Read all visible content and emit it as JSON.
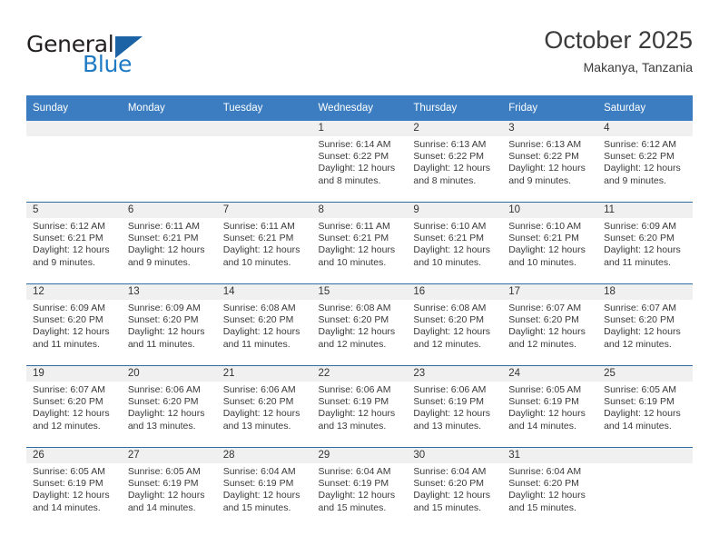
{
  "brand": {
    "word_one": "General",
    "word_two": "Blue",
    "triangle_color": "#1b63a5",
    "blue_color": "#1f7ac4"
  },
  "header": {
    "title": "October 2025",
    "subtitle": "Makanya, Tanzania",
    "header_bg": "#3b7dc0",
    "row_divider": "#2e6da4",
    "daynum_bg": "#f0f0f0"
  },
  "weekdays": [
    "Sunday",
    "Monday",
    "Tuesday",
    "Wednesday",
    "Thursday",
    "Friday",
    "Saturday"
  ],
  "labels": {
    "sunrise": "Sunrise:",
    "sunset": "Sunset:",
    "daylight": "Daylight:"
  },
  "weeks": [
    [
      {
        "day": "",
        "sunrise": "",
        "sunset": "",
        "daylight_1": "",
        "daylight_2": ""
      },
      {
        "day": "",
        "sunrise": "",
        "sunset": "",
        "daylight_1": "",
        "daylight_2": ""
      },
      {
        "day": "",
        "sunrise": "",
        "sunset": "",
        "daylight_1": "",
        "daylight_2": ""
      },
      {
        "day": "1",
        "sunrise": "Sunrise: 6:14 AM",
        "sunset": "Sunset: 6:22 PM",
        "daylight_1": "Daylight: 12 hours",
        "daylight_2": "and 8 minutes."
      },
      {
        "day": "2",
        "sunrise": "Sunrise: 6:13 AM",
        "sunset": "Sunset: 6:22 PM",
        "daylight_1": "Daylight: 12 hours",
        "daylight_2": "and 8 minutes."
      },
      {
        "day": "3",
        "sunrise": "Sunrise: 6:13 AM",
        "sunset": "Sunset: 6:22 PM",
        "daylight_1": "Daylight: 12 hours",
        "daylight_2": "and 9 minutes."
      },
      {
        "day": "4",
        "sunrise": "Sunrise: 6:12 AM",
        "sunset": "Sunset: 6:22 PM",
        "daylight_1": "Daylight: 12 hours",
        "daylight_2": "and 9 minutes."
      }
    ],
    [
      {
        "day": "5",
        "sunrise": "Sunrise: 6:12 AM",
        "sunset": "Sunset: 6:21 PM",
        "daylight_1": "Daylight: 12 hours",
        "daylight_2": "and 9 minutes."
      },
      {
        "day": "6",
        "sunrise": "Sunrise: 6:11 AM",
        "sunset": "Sunset: 6:21 PM",
        "daylight_1": "Daylight: 12 hours",
        "daylight_2": "and 9 minutes."
      },
      {
        "day": "7",
        "sunrise": "Sunrise: 6:11 AM",
        "sunset": "Sunset: 6:21 PM",
        "daylight_1": "Daylight: 12 hours",
        "daylight_2": "and 10 minutes."
      },
      {
        "day": "8",
        "sunrise": "Sunrise: 6:11 AM",
        "sunset": "Sunset: 6:21 PM",
        "daylight_1": "Daylight: 12 hours",
        "daylight_2": "and 10 minutes."
      },
      {
        "day": "9",
        "sunrise": "Sunrise: 6:10 AM",
        "sunset": "Sunset: 6:21 PM",
        "daylight_1": "Daylight: 12 hours",
        "daylight_2": "and 10 minutes."
      },
      {
        "day": "10",
        "sunrise": "Sunrise: 6:10 AM",
        "sunset": "Sunset: 6:21 PM",
        "daylight_1": "Daylight: 12 hours",
        "daylight_2": "and 10 minutes."
      },
      {
        "day": "11",
        "sunrise": "Sunrise: 6:09 AM",
        "sunset": "Sunset: 6:20 PM",
        "daylight_1": "Daylight: 12 hours",
        "daylight_2": "and 11 minutes."
      }
    ],
    [
      {
        "day": "12",
        "sunrise": "Sunrise: 6:09 AM",
        "sunset": "Sunset: 6:20 PM",
        "daylight_1": "Daylight: 12 hours",
        "daylight_2": "and 11 minutes."
      },
      {
        "day": "13",
        "sunrise": "Sunrise: 6:09 AM",
        "sunset": "Sunset: 6:20 PM",
        "daylight_1": "Daylight: 12 hours",
        "daylight_2": "and 11 minutes."
      },
      {
        "day": "14",
        "sunrise": "Sunrise: 6:08 AM",
        "sunset": "Sunset: 6:20 PM",
        "daylight_1": "Daylight: 12 hours",
        "daylight_2": "and 11 minutes."
      },
      {
        "day": "15",
        "sunrise": "Sunrise: 6:08 AM",
        "sunset": "Sunset: 6:20 PM",
        "daylight_1": "Daylight: 12 hours",
        "daylight_2": "and 12 minutes."
      },
      {
        "day": "16",
        "sunrise": "Sunrise: 6:08 AM",
        "sunset": "Sunset: 6:20 PM",
        "daylight_1": "Daylight: 12 hours",
        "daylight_2": "and 12 minutes."
      },
      {
        "day": "17",
        "sunrise": "Sunrise: 6:07 AM",
        "sunset": "Sunset: 6:20 PM",
        "daylight_1": "Daylight: 12 hours",
        "daylight_2": "and 12 minutes."
      },
      {
        "day": "18",
        "sunrise": "Sunrise: 6:07 AM",
        "sunset": "Sunset: 6:20 PM",
        "daylight_1": "Daylight: 12 hours",
        "daylight_2": "and 12 minutes."
      }
    ],
    [
      {
        "day": "19",
        "sunrise": "Sunrise: 6:07 AM",
        "sunset": "Sunset: 6:20 PM",
        "daylight_1": "Daylight: 12 hours",
        "daylight_2": "and 12 minutes."
      },
      {
        "day": "20",
        "sunrise": "Sunrise: 6:06 AM",
        "sunset": "Sunset: 6:20 PM",
        "daylight_1": "Daylight: 12 hours",
        "daylight_2": "and 13 minutes."
      },
      {
        "day": "21",
        "sunrise": "Sunrise: 6:06 AM",
        "sunset": "Sunset: 6:20 PM",
        "daylight_1": "Daylight: 12 hours",
        "daylight_2": "and 13 minutes."
      },
      {
        "day": "22",
        "sunrise": "Sunrise: 6:06 AM",
        "sunset": "Sunset: 6:19 PM",
        "daylight_1": "Daylight: 12 hours",
        "daylight_2": "and 13 minutes."
      },
      {
        "day": "23",
        "sunrise": "Sunrise: 6:06 AM",
        "sunset": "Sunset: 6:19 PM",
        "daylight_1": "Daylight: 12 hours",
        "daylight_2": "and 13 minutes."
      },
      {
        "day": "24",
        "sunrise": "Sunrise: 6:05 AM",
        "sunset": "Sunset: 6:19 PM",
        "daylight_1": "Daylight: 12 hours",
        "daylight_2": "and 14 minutes."
      },
      {
        "day": "25",
        "sunrise": "Sunrise: 6:05 AM",
        "sunset": "Sunset: 6:19 PM",
        "daylight_1": "Daylight: 12 hours",
        "daylight_2": "and 14 minutes."
      }
    ],
    [
      {
        "day": "26",
        "sunrise": "Sunrise: 6:05 AM",
        "sunset": "Sunset: 6:19 PM",
        "daylight_1": "Daylight: 12 hours",
        "daylight_2": "and 14 minutes."
      },
      {
        "day": "27",
        "sunrise": "Sunrise: 6:05 AM",
        "sunset": "Sunset: 6:19 PM",
        "daylight_1": "Daylight: 12 hours",
        "daylight_2": "and 14 minutes."
      },
      {
        "day": "28",
        "sunrise": "Sunrise: 6:04 AM",
        "sunset": "Sunset: 6:19 PM",
        "daylight_1": "Daylight: 12 hours",
        "daylight_2": "and 15 minutes."
      },
      {
        "day": "29",
        "sunrise": "Sunrise: 6:04 AM",
        "sunset": "Sunset: 6:19 PM",
        "daylight_1": "Daylight: 12 hours",
        "daylight_2": "and 15 minutes."
      },
      {
        "day": "30",
        "sunrise": "Sunrise: 6:04 AM",
        "sunset": "Sunset: 6:20 PM",
        "daylight_1": "Daylight: 12 hours",
        "daylight_2": "and 15 minutes."
      },
      {
        "day": "31",
        "sunrise": "Sunrise: 6:04 AM",
        "sunset": "Sunset: 6:20 PM",
        "daylight_1": "Daylight: 12 hours",
        "daylight_2": "and 15 minutes."
      },
      {
        "day": "",
        "sunrise": "",
        "sunset": "",
        "daylight_1": "",
        "daylight_2": ""
      }
    ]
  ]
}
